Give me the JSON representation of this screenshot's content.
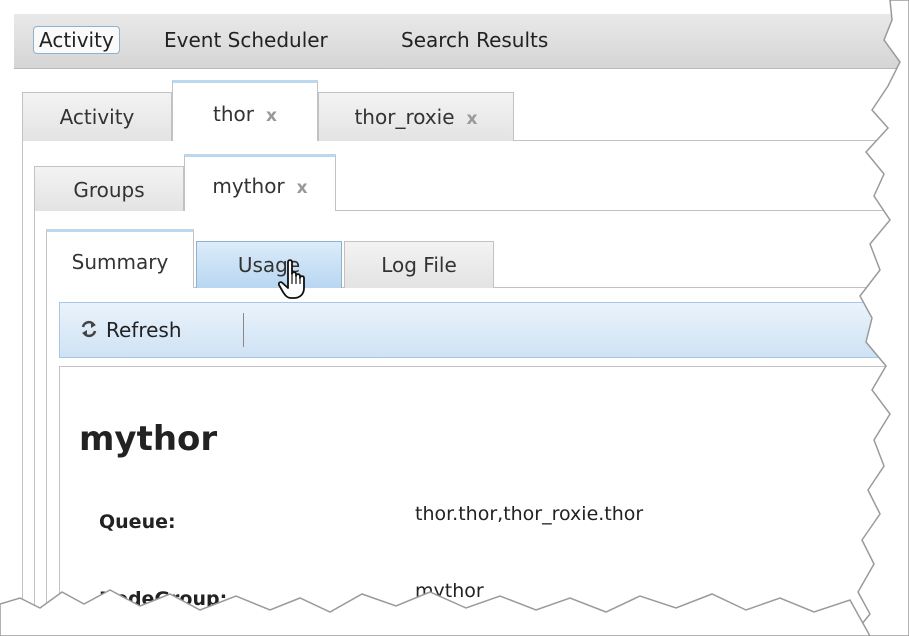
{
  "top_menu": {
    "items": [
      "Activity",
      "Event Scheduler",
      "Search Results"
    ],
    "active": "Activity"
  },
  "level1_tabs": [
    {
      "label": "Activity",
      "closable": false
    },
    {
      "label": "thor",
      "closable": true,
      "selected": true
    },
    {
      "label": "thor_roxie",
      "closable": true
    }
  ],
  "level2_tabs": [
    {
      "label": "Groups",
      "closable": false
    },
    {
      "label": "mythor",
      "closable": true,
      "selected": true
    }
  ],
  "level3_tabs": [
    {
      "label": "Summary",
      "selected": true
    },
    {
      "label": "Usage",
      "hovered": true
    },
    {
      "label": "Log File"
    }
  ],
  "close_glyph": "x",
  "toolbar": {
    "refresh_label": "Refresh",
    "refresh_icon": "refresh-icon"
  },
  "summary": {
    "title": "mythor",
    "fields": [
      {
        "label": "Queue:",
        "value": "thor.thor,thor_roxie.thor"
      },
      {
        "label": "NodeGroup:",
        "value": "mythor"
      }
    ]
  },
  "colors": {
    "hover_tab": "#b8d6f1",
    "toolbar": "#cfe2f4",
    "active_border": "#8fb1cc"
  }
}
